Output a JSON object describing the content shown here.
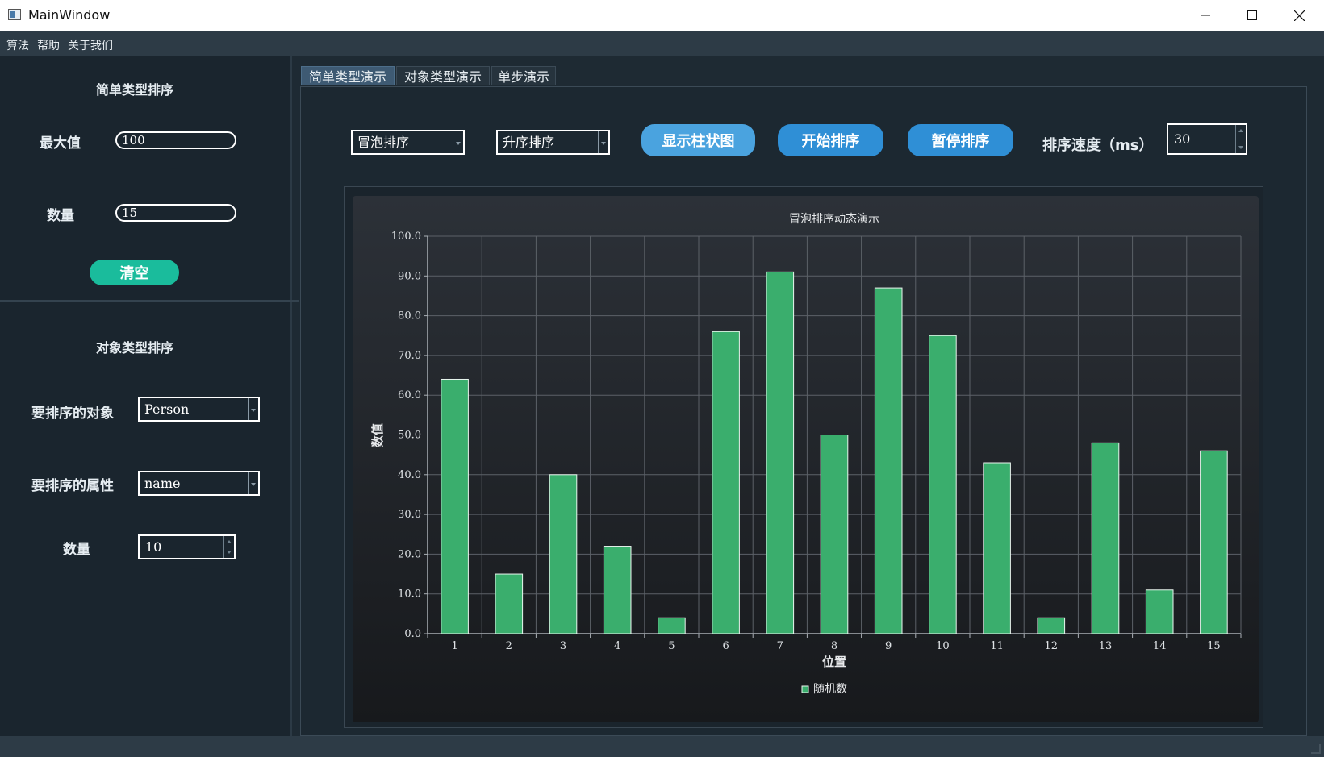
{
  "window": {
    "title": "MainWindow"
  },
  "menu": [
    "算法",
    "帮助",
    "关于我们"
  ],
  "left": {
    "simple_title": "简单类型排序",
    "max_label": "最大值",
    "max_value": "100",
    "count_label": "数量",
    "count_value": "15",
    "clear_label": "清空",
    "object_title": "对象类型排序",
    "object_label": "要排序的对象",
    "object_value": "Person",
    "attr_label": "要排序的属性",
    "attr_value": "name",
    "obj_count_label": "数量",
    "obj_count_value": "10"
  },
  "tabs": [
    "简单类型演示",
    "对象类型演示",
    "单步演示"
  ],
  "controls": {
    "algorithm": "冒泡排序",
    "order": "升序排序",
    "show_chart": "显示柱状图",
    "start": "开始排序",
    "pause": "暂停排序",
    "speed_label": "排序速度（ms）",
    "speed_value": "30"
  },
  "colors": {
    "bar": "#3aae6d",
    "button_light": "#4aa3df",
    "button_blue": "#2f8fd6",
    "clear_button": "#1abc9c"
  },
  "chart_data": {
    "type": "bar",
    "title": "冒泡排序动态演示",
    "xlabel": "位置",
    "ylabel": "数值",
    "categories": [
      "1",
      "2",
      "3",
      "4",
      "5",
      "6",
      "7",
      "8",
      "9",
      "10",
      "11",
      "12",
      "13",
      "14",
      "15"
    ],
    "series": [
      {
        "name": "随机数",
        "values": [
          64,
          15,
          40,
          22,
          4,
          76,
          91,
          50,
          87,
          75,
          43,
          4,
          48,
          11,
          46
        ]
      }
    ],
    "yticks": [
      "0.0",
      "10.0",
      "20.0",
      "30.0",
      "40.0",
      "50.0",
      "60.0",
      "70.0",
      "80.0",
      "90.0",
      "100.0"
    ],
    "ylim": [
      0,
      100
    ],
    "grid": true,
    "legend": "bottom"
  }
}
